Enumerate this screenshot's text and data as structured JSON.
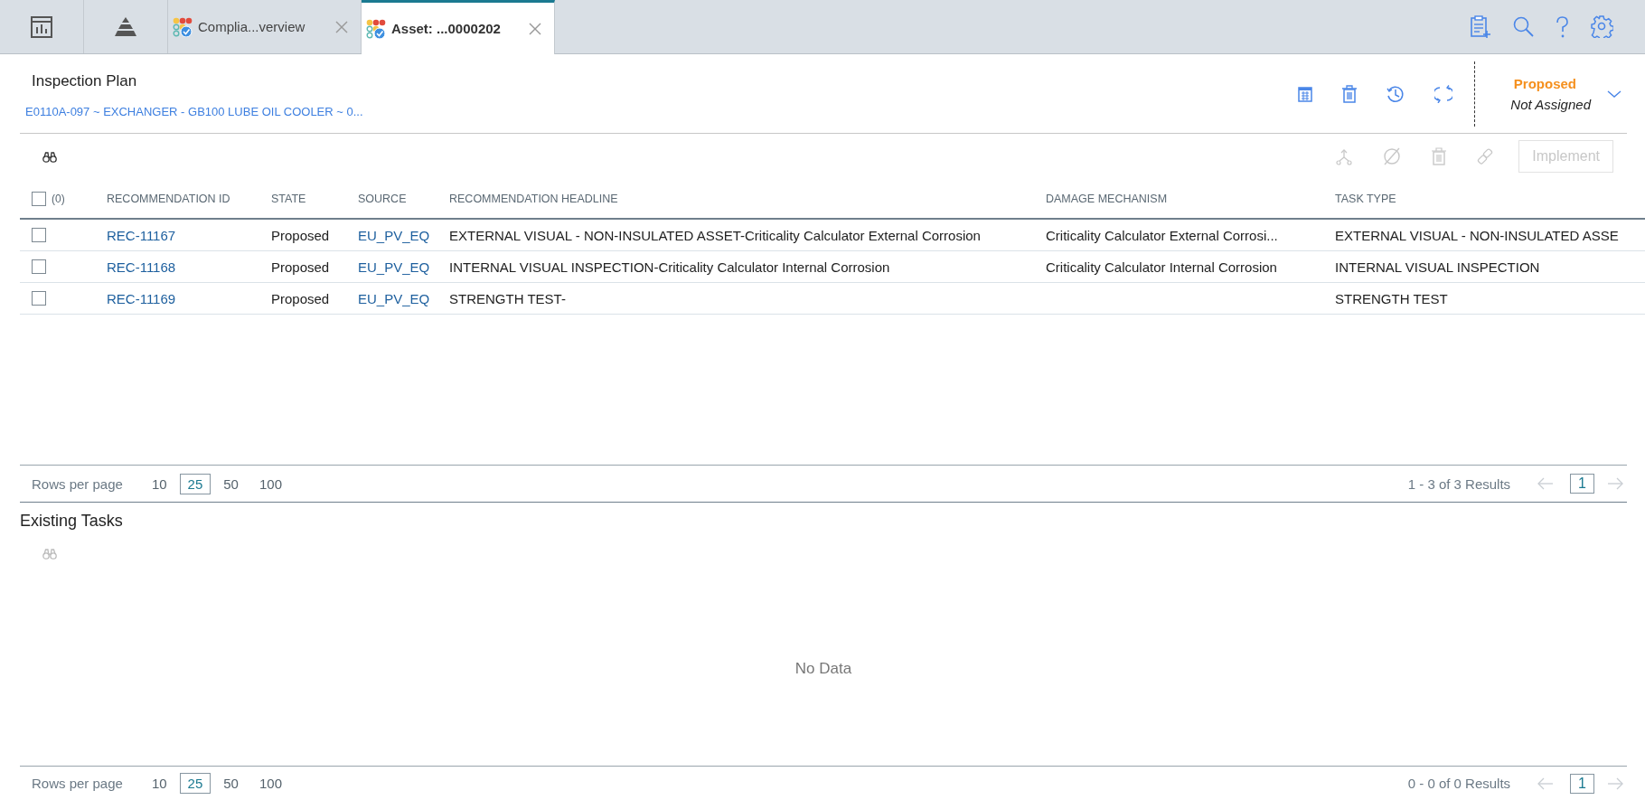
{
  "tabs": [
    {
      "label": "Complia...verview",
      "selected": false
    },
    {
      "label": "Asset: ...0000202",
      "selected": true
    }
  ],
  "header": {
    "title": "Inspection Plan",
    "asset_link": "E0110A-097 ~ EXCHANGER - GB100 LUBE OIL COOLER ~ 0...",
    "state": "Proposed",
    "assignee": "Not Assigned"
  },
  "recommendations": {
    "all_checked": false,
    "selected_count": "(0)",
    "implement": {
      "label": "Implement",
      "disabled": true
    },
    "columns": [
      "RECOMMENDATION ID",
      "STATE",
      "SOURCE",
      "RECOMMENDATION HEADLINE",
      "DAMAGE MECHANISM",
      "TASK TYPE"
    ],
    "rows": [
      {
        "checked": false,
        "id": "REC-11167",
        "state": "Proposed",
        "source": "EU_PV_EQ",
        "headline": "EXTERNAL VISUAL - NON-INSULATED ASSET-Criticality Calculator External Corrosion",
        "damage_mechanism": "Criticality Calculator External Corrosi...",
        "task_type": "EXTERNAL VISUAL - NON-INSULATED ASSE"
      },
      {
        "checked": false,
        "id": "REC-11168",
        "state": "Proposed",
        "source": "EU_PV_EQ",
        "headline": "INTERNAL VISUAL INSPECTION-Criticality Calculator Internal Corrosion",
        "damage_mechanism": "Criticality Calculator Internal Corrosion",
        "task_type": "INTERNAL VISUAL INSPECTION"
      },
      {
        "checked": false,
        "id": "REC-11169",
        "state": "Proposed",
        "source": "EU_PV_EQ",
        "headline": "STRENGTH TEST-",
        "damage_mechanism": "",
        "task_type": "STRENGTH TEST"
      }
    ],
    "pager": {
      "label": "Rows per page",
      "sizes": [
        {
          "label": "10",
          "selected": false
        },
        {
          "label": "25",
          "selected": true
        },
        {
          "label": "50",
          "selected": false
        },
        {
          "label": "100",
          "selected": false
        }
      ],
      "summary": "1 - 3 of 3 Results",
      "page": "1"
    }
  },
  "existing_tasks": {
    "title": "Existing Tasks",
    "empty_text": "No Data",
    "pager": {
      "label": "Rows per page",
      "sizes": [
        {
          "label": "10",
          "selected": false
        },
        {
          "label": "25",
          "selected": true
        },
        {
          "label": "50",
          "selected": false
        },
        {
          "label": "100",
          "selected": false
        }
      ],
      "summary": "0 - 0 of 0 Results",
      "page": "1"
    }
  }
}
